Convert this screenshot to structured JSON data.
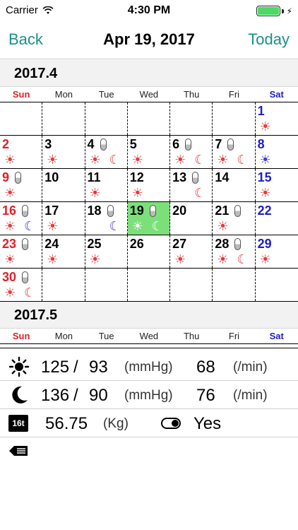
{
  "status": {
    "carrier": "Carrier",
    "time": "4:30 PM",
    "battery_icon": "battery-full-icon",
    "wifi_icon": "wifi-icon"
  },
  "nav": {
    "back_label": "Back",
    "title": "Apr 19, 2017",
    "today_label": "Today"
  },
  "weekdays": [
    "Sun",
    "Mon",
    "Tue",
    "Wed",
    "Thu",
    "Fri",
    "Sat"
  ],
  "months": [
    {
      "label": "2017.4",
      "weeks": [
        [
          null,
          null,
          null,
          null,
          null,
          null,
          {
            "d": "1",
            "sun": true
          }
        ],
        [
          {
            "d": "2",
            "sun": true
          },
          {
            "d": "3",
            "sun": true
          },
          {
            "d": "4",
            "pill": true,
            "sun": true,
            "moon": true
          },
          {
            "d": "5",
            "sun": true
          },
          {
            "d": "6",
            "pill": true,
            "sun": true,
            "moon": true
          },
          {
            "d": "7",
            "pill": true,
            "sun": true,
            "moon": true
          },
          {
            "d": "8",
            "sun": true,
            "blue": true
          }
        ],
        [
          {
            "d": "9",
            "pill": true,
            "sun": true
          },
          {
            "d": "10"
          },
          {
            "d": "11",
            "sun": true
          },
          {
            "d": "12",
            "sun": true
          },
          {
            "d": "13",
            "pill": true,
            "moon": true
          },
          {
            "d": "14"
          },
          {
            "d": "15",
            "sun": true
          }
        ],
        [
          {
            "d": "16",
            "pill": true,
            "sun": true,
            "moon": true,
            "blue": true
          },
          {
            "d": "17",
            "sun": true
          },
          {
            "d": "18",
            "pill": true,
            "moon": true,
            "blue": true
          },
          {
            "d": "19",
            "pill": true,
            "sun": true,
            "moon": true,
            "selected": true
          },
          {
            "d": "20"
          },
          {
            "d": "21",
            "pill": true,
            "sun": true
          },
          {
            "d": "22"
          }
        ],
        [
          {
            "d": "23",
            "pill": true,
            "sun": true
          },
          {
            "d": "24",
            "sun": true
          },
          {
            "d": "25",
            "sun": true
          },
          {
            "d": "26"
          },
          {
            "d": "27",
            "sun": true
          },
          {
            "d": "28",
            "pill": true,
            "sun": true,
            "moon": true
          },
          {
            "d": "29",
            "sun": true
          }
        ],
        [
          {
            "d": "30",
            "pill": true,
            "sun": true,
            "moon": true
          },
          null,
          null,
          null,
          null,
          null,
          null
        ]
      ]
    },
    {
      "label": "2017.5",
      "weeks": []
    }
  ],
  "readings": {
    "morning": {
      "icon": "sun-icon",
      "systolic": "125",
      "separator": "/",
      "diastolic": "93",
      "unit": "(mmHg)",
      "pulse": "68",
      "pulse_unit": "(/min)"
    },
    "evening": {
      "icon": "moon-icon",
      "systolic": "136",
      "separator": "/",
      "diastolic": "90",
      "unit": "(mmHg)",
      "pulse": "76",
      "pulse_unit": "(/min)"
    },
    "weight": {
      "icon": "scale-icon",
      "icon_text": "16t",
      "value": "56.75",
      "unit": "(Kg)"
    },
    "medication": {
      "icon": "pill-toggle-icon",
      "value": "Yes"
    },
    "memo": {
      "icon": "memo-icon"
    }
  },
  "colors": {
    "accent": "#1a8f8a",
    "sunday": "#e0202a",
    "saturday": "#2020c0",
    "selected": "#7ce07a",
    "icon_red": "#e8383a",
    "icon_blue": "#3a3ae8"
  }
}
